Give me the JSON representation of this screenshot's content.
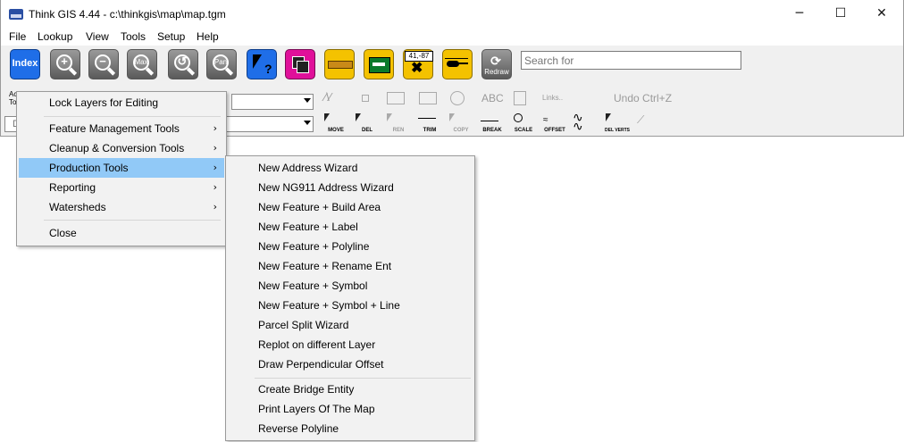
{
  "window": {
    "title": "Think GIS 4.44 - c:\\thinkgis\\map\\map.tgm",
    "minimize_glyph": "─",
    "maximize_glyph": "☐",
    "close_glyph": "✕"
  },
  "menubar": [
    "File",
    "Lookup",
    "View",
    "Tools",
    "Setup",
    "Help"
  ],
  "toolbar": {
    "index": "Index",
    "zoom_in_icon": "zoom-in-icon",
    "zoom_out_icon": "zoom-out-icon",
    "max": "Max",
    "previous_icon": "previous-view-icon",
    "pan": "Pan",
    "identify_icon": "identify-icon",
    "layers_icon": "layers-icon",
    "measure_icon": "ruler-icon",
    "print_icon": "printer-icon",
    "coords": "41,-87",
    "helicopter_icon": "helicopter-icon",
    "redraw": "Redraw",
    "search_placeholder": "Search for"
  },
  "row2": {
    "layer_label_1": "Ac",
    "layer_label_2": "To",
    "layer_value_2": "D",
    "links": "Links..",
    "undo": "Undo  Ctrl+Z",
    "abc": "ABC",
    "tools": [
      "MOVE",
      "DEL",
      "REN",
      "TRIM",
      "COPY",
      "BREAK",
      "SCALE",
      "OFFSET",
      "",
      "DEL VERTS"
    ]
  },
  "tools_menu": {
    "lock_layers": "Lock Layers for Editing",
    "items": [
      "Feature Management Tools",
      "Cleanup & Conversion Tools",
      "Production Tools",
      "Reporting",
      "Watersheds"
    ],
    "close": "Close",
    "submenu_arrow": "›"
  },
  "production_menu": {
    "group1": [
      "New Address Wizard",
      "New NG911 Address Wizard",
      "New Feature + Build Area",
      "New Feature + Label",
      "New Feature + Polyline",
      "New Feature + Rename Ent",
      "New Feature + Symbol",
      "New Feature + Symbol + Line",
      "Parcel Split Wizard",
      "Replot on different Layer",
      "Draw Perpendicular Offset"
    ],
    "group2": [
      "Create Bridge Entity",
      "Print Layers Of The Map",
      "Reverse Polyline"
    ]
  },
  "colors": {
    "highlight": "#91c9f7",
    "index_button": "#1f6ee8",
    "identify_button": "#1f6ee8",
    "layers_button": "#e0109a",
    "yellow_button": "#f4c200",
    "menu_background": "#f2f2f2"
  }
}
